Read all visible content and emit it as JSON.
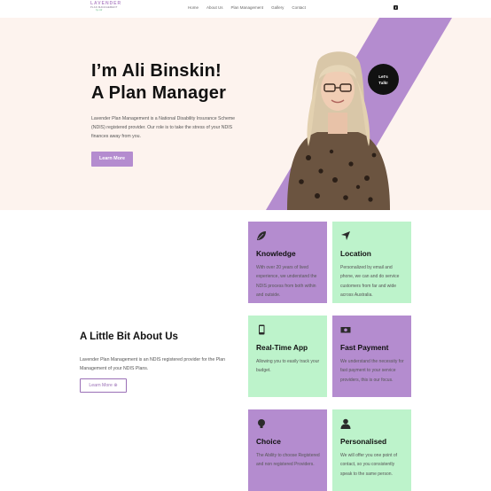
{
  "header": {
    "logo": {
      "line1": "LAVENDER",
      "line2": "PLAN MANAGEMENT",
      "line3": "by Ali"
    },
    "nav": [
      "Home",
      "About Us",
      "Plan Management",
      "Gallery",
      "Contact"
    ],
    "social_icon": "facebook-icon",
    "social_glyph": "f"
  },
  "hero": {
    "title_line1": "I’m Ali Binskin!",
    "title_line2": "A Plan Manager",
    "description": "Lavender Plan Management is a National Disability Insurance Scheme (NDIS) registered provider. Our role is to take the stress of your NDIS finances away from you.",
    "button_label": "Learn More",
    "talk_line1": "Let’s",
    "talk_line2": "Talk!"
  },
  "about": {
    "title": "A Little Bit About Us",
    "description": "Lavender Plan Management is an NDIS registered provider for the Plan Management of your NDIS Plans.",
    "button_label": "Learn More ⊕"
  },
  "cards": [
    {
      "title": "Knowledge",
      "icon": "leaf-icon",
      "description": "With over 20 years of lived experience, we understand the NDIS process from both within and outside."
    },
    {
      "title": "Location",
      "icon": "navigation-arrow-icon",
      "description": "Personalized by email and phone, we can and do service customers from far and wide across Australia."
    },
    {
      "title": "Real-Time App",
      "icon": "mobile-phone-icon",
      "description": "Allowing you to easily track your budget."
    },
    {
      "title": "Fast Payment",
      "icon": "money-bill-icon",
      "description": "We understand the necessity for fast payment to your service providers, this is our focus."
    },
    {
      "title": "Choice",
      "icon": "lightbulb-icon",
      "description": "The Ability to choose Registered and non registered Providers."
    },
    {
      "title": "Personalised",
      "icon": "user-icon",
      "description": "We will offer you one point of contact, so you consistently speak to the same person."
    }
  ],
  "colors": {
    "lavender": "#b48ccf",
    "mint": "#bdf3cb",
    "hero_bg": "#fdf3ee"
  }
}
